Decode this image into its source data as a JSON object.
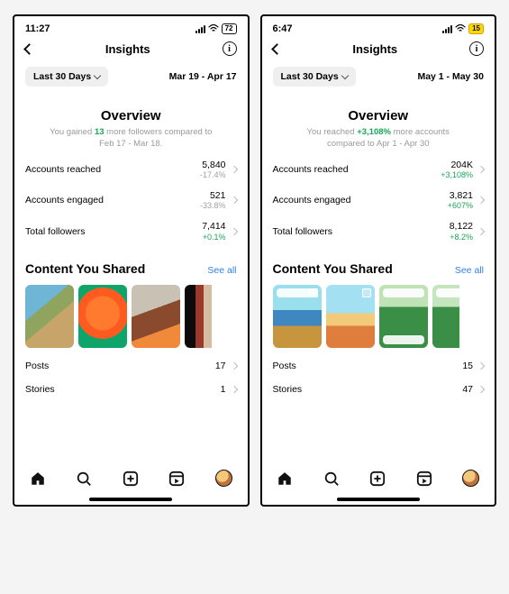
{
  "screens": [
    {
      "status": {
        "time": "11:27",
        "battery": "72"
      },
      "nav": {
        "title": "Insights"
      },
      "range": {
        "pill": "Last 30 Days",
        "dates": "Mar 19 - Apr 17"
      },
      "overview": {
        "heading": "Overview",
        "sub_pre": "You gained ",
        "sub_gain": "13",
        "sub_post": " more followers compared to Feb 17 - Mar 18.",
        "metrics": [
          {
            "label": "Accounts reached",
            "value": "5,840",
            "delta": "-17.4%",
            "dir": "down"
          },
          {
            "label": "Accounts engaged",
            "value": "521",
            "delta": "-33.8%",
            "dir": "down"
          },
          {
            "label": "Total followers",
            "value": "7,414",
            "delta": "+0.1%",
            "dir": "up"
          }
        ]
      },
      "content": {
        "heading": "Content You Shared",
        "see_all": "See all",
        "rows": [
          {
            "label": "Posts",
            "value": "17"
          },
          {
            "label": "Stories",
            "value": "1"
          }
        ]
      }
    },
    {
      "status": {
        "time": "6:47",
        "battery": "15"
      },
      "nav": {
        "title": "Insights"
      },
      "range": {
        "pill": "Last 30 Days",
        "dates": "May 1 - May 30"
      },
      "overview": {
        "heading": "Overview",
        "sub_pre": "You reached ",
        "sub_gain": "+3,108%",
        "sub_post": " more accounts compared to Apr 1 - Apr 30",
        "metrics": [
          {
            "label": "Accounts reached",
            "value": "204K",
            "delta": "+3,108%",
            "dir": "up"
          },
          {
            "label": "Accounts engaged",
            "value": "3,821",
            "delta": "+607%",
            "dir": "up"
          },
          {
            "label": "Total followers",
            "value": "8,122",
            "delta": "+8.2%",
            "dir": "up"
          }
        ]
      },
      "content": {
        "heading": "Content You Shared",
        "see_all": "See all",
        "rows": [
          {
            "label": "Posts",
            "value": "15"
          },
          {
            "label": "Stories",
            "value": "47"
          }
        ]
      }
    }
  ]
}
